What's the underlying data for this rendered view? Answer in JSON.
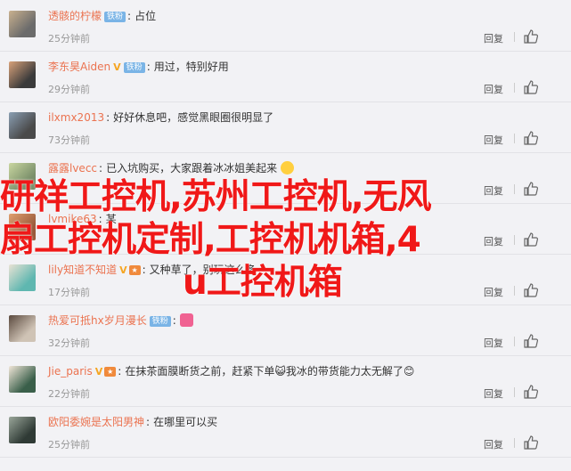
{
  "comments": [
    {
      "user": "透骸的柠檬",
      "badge": "铁粉",
      "vip": false,
      "medal": false,
      "text": "占位",
      "emoji": "",
      "time": "25分钟前",
      "avatar_color": "#6b6b6b",
      "avatar_accent": "#c9b18f"
    },
    {
      "user": "李东昊Aiden",
      "badge": "铁粉",
      "vip": true,
      "medal": false,
      "text": "用过，特别好用",
      "emoji": "",
      "time": "29分钟前",
      "avatar_color": "#3b3b3b",
      "avatar_accent": "#d9a27a"
    },
    {
      "user": "ilxmx2013",
      "badge": "",
      "vip": false,
      "medal": false,
      "text": "好好休息吧，感觉黑眼圈很明显了",
      "emoji": "",
      "time": "73分钟前",
      "avatar_color": "#4a4a4a",
      "avatar_accent": "#8a9fb3"
    },
    {
      "user": "露露lvecc",
      "badge": "",
      "vip": false,
      "medal": false,
      "text": "已入坑购买，大家跟着冰冰姐美起来",
      "emoji": "grin",
      "time": "",
      "avatar_color": "#7a8f6a",
      "avatar_accent": "#c9d6a0"
    },
    {
      "user": "lvmike63",
      "badge": "",
      "vip": false,
      "medal": false,
      "text": "某",
      "emoji": "",
      "time": "",
      "avatar_color": "#9a5a3a",
      "avatar_accent": "#e0a070"
    },
    {
      "user": "lily知道不知道",
      "badge": "",
      "vip": true,
      "medal": true,
      "text": "又种草了，别玩这么多",
      "emoji": "",
      "time": "17分钟前",
      "avatar_color": "#5fb7b0",
      "avatar_accent": "#e9e2d4"
    },
    {
      "user": "热爱可抵hx岁月漫长",
      "badge": "铁粉",
      "vip": false,
      "medal": false,
      "text": "",
      "emoji": "heart",
      "time": "32分钟前",
      "avatar_color": "#cfc3b5",
      "avatar_accent": "#5b4a3f"
    },
    {
      "user": "Jie_paris",
      "badge": "",
      "vip": true,
      "medal": true,
      "text": "在抹茶面膜断货之前，赶紧下单😺我冰的带货能力太无解了😊",
      "emoji": "",
      "time": "22分钟前",
      "avatar_color": "#3a5f4a",
      "avatar_accent": "#f1e6d8"
    },
    {
      "user": "欧阳委婉是太阳男神",
      "badge": "",
      "vip": false,
      "medal": false,
      "text": "在哪里可以买",
      "emoji": "",
      "time": "25分钟前",
      "avatar_color": "#2f3a35",
      "avatar_accent": "#9aa69a"
    }
  ],
  "actions": {
    "reply": "回复",
    "colon": ":"
  },
  "overlay_text": {
    "line1": "研祥工控机,苏州工控机,无风",
    "line2": "扇工控机定制,工控机机箱,4",
    "line3": "u工控机箱"
  }
}
